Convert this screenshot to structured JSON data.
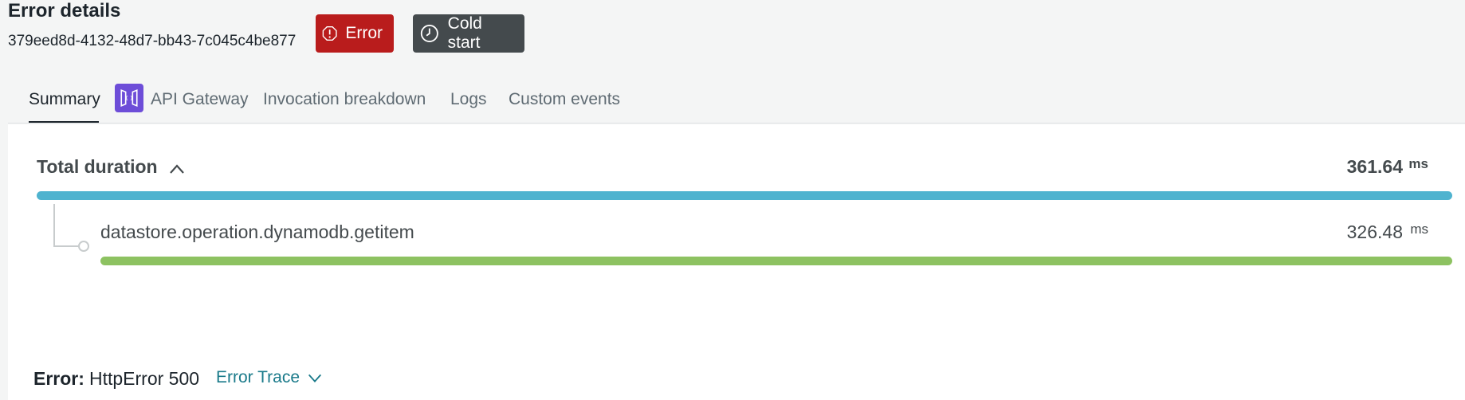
{
  "header": {
    "title": "Error details",
    "id": "379eed8d-4132-48d7-bb43-7c045c4be877"
  },
  "badges": {
    "error": "Error",
    "cold_start": "Cold start"
  },
  "tabs": [
    {
      "label": "Summary",
      "active": true
    },
    {
      "label": "API Gateway",
      "icon": "api-gateway-icon"
    },
    {
      "label": "Invocation breakdown"
    },
    {
      "label": "Logs"
    },
    {
      "label": "Custom events"
    }
  ],
  "duration": {
    "label": "Total duration",
    "value": "361.64",
    "unit": "ms",
    "color": "#4fb3cf"
  },
  "spans": [
    {
      "label": "datastore.operation.dynamodb.getitem",
      "value": "326.48",
      "unit": "ms",
      "color": "#8dc261"
    }
  ],
  "error": {
    "label": "Error:",
    "value": "HttpError 500",
    "trace_label": "Error Trace"
  },
  "colors": {
    "error_badge": "#b91c1c",
    "cold_badge": "#444a4d",
    "link": "#1a7a8a",
    "apigw": "#6d4dd8"
  }
}
